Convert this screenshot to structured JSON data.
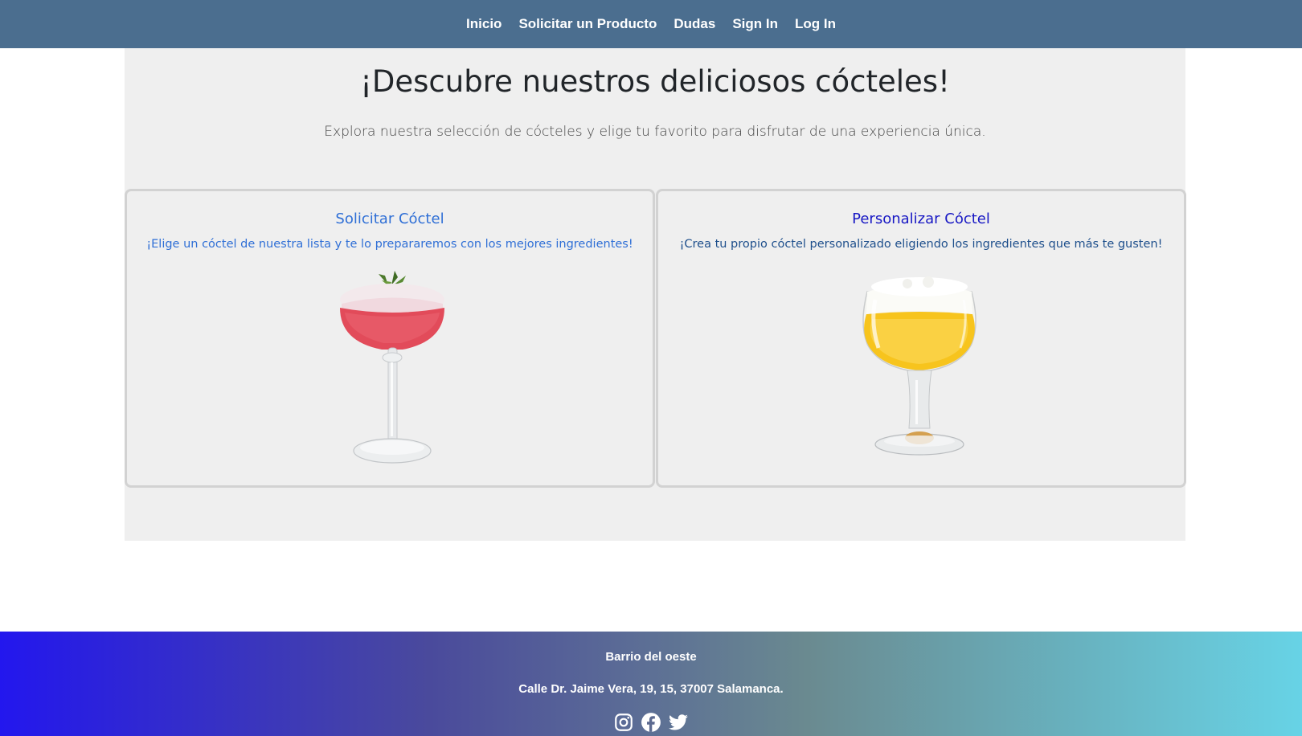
{
  "nav": {
    "items": [
      {
        "label": "Inicio"
      },
      {
        "label": "Solicitar un Producto"
      },
      {
        "label": "Dudas"
      },
      {
        "label": "Sign In"
      },
      {
        "label": "Log In"
      }
    ]
  },
  "hero": {
    "title": "¡Descubre nuestros deliciosos cócteles!",
    "subtitle": "Explora nuestra selección de cócteles y elige tu favorito para disfrutar de una experiencia única."
  },
  "cards": [
    {
      "title": "Solicitar Cóctel",
      "text": "¡Elige un cóctel de nuestra lista y te lo prepararemos con los mejores ingredientes!",
      "image": "pink-cocktail-coupe-glass"
    },
    {
      "title": "Personalizar Cóctel",
      "text": "¡Crea tu propio cóctel personalizado eligiendo los ingredientes que más te gusten!",
      "image": "beer-goblet-glass"
    }
  ],
  "footer": {
    "name": "Barrio del oeste",
    "address": "Calle Dr. Jaime Vera, 19, 15, 37007 Salamanca.",
    "social": [
      "instagram-icon",
      "facebook-icon",
      "twitter-icon"
    ]
  },
  "colors": {
    "navbar": "#4b6e8f",
    "main_bg": "#efefef",
    "card_border": "#d2d2d2",
    "left_card_accent": "#2f6fd6",
    "right_card_title": "#1818c4",
    "footer_gradient_start": "#2317ee",
    "footer_gradient_end": "#67d3e6"
  }
}
